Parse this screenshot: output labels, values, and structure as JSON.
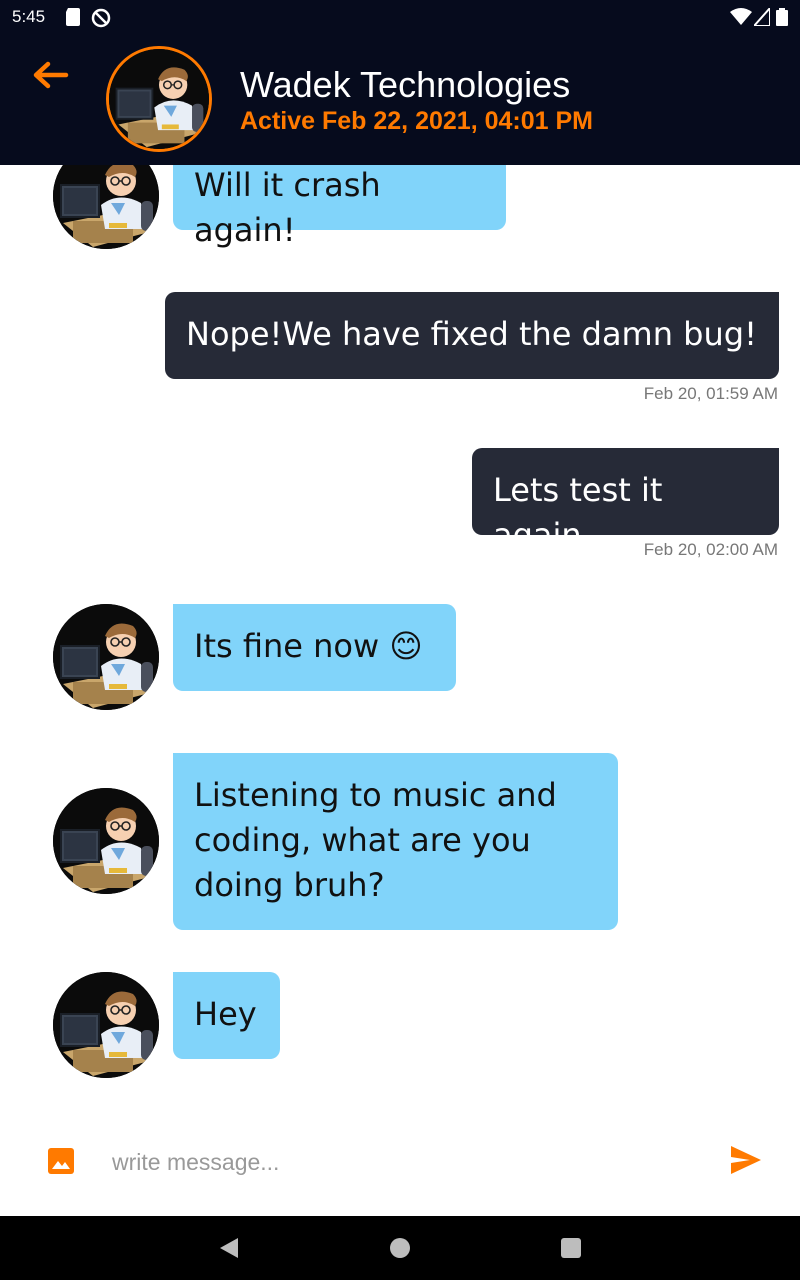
{
  "status_bar": {
    "time": "5:45"
  },
  "header": {
    "title": "Wadek Technologies",
    "subtitle": "Active Feb 22, 2021, 04:01 PM",
    "accent_color": "#ff7a00"
  },
  "messages": [
    {
      "direction": "incoming",
      "text": "Will it crash again!"
    },
    {
      "direction": "outgoing",
      "text": "Nope!We have fixed the damn bug!",
      "timestamp": "Feb 20, 01:59 AM"
    },
    {
      "direction": "outgoing",
      "text": "Lets test it again",
      "timestamp": "Feb 20, 02:00 AM"
    },
    {
      "direction": "incoming",
      "text": "Its fine now 😊"
    },
    {
      "direction": "incoming",
      "text": "Listening to music and coding, what are you doing bruh?"
    },
    {
      "direction": "incoming",
      "text": "Hey"
    }
  ],
  "composer": {
    "placeholder": "write message..."
  },
  "icons": {
    "back": "back-arrow-icon",
    "image": "image-icon",
    "send": "send-icon"
  }
}
